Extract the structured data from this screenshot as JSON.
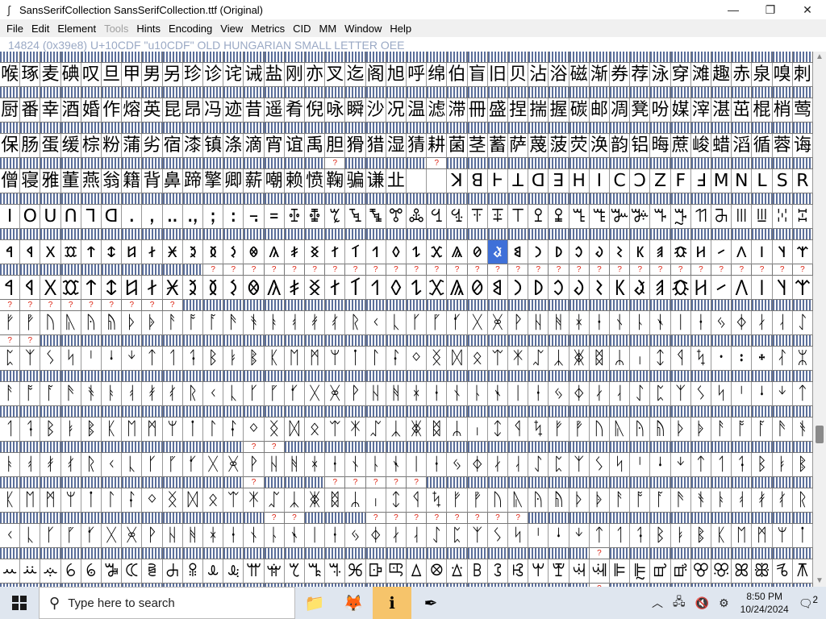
{
  "window": {
    "title": "SansSerifCollection  SansSerifCollection.ttf (Original)",
    "app_icon": "fontforge-icon",
    "controls": [
      "—",
      "❐",
      "✕"
    ]
  },
  "menu": {
    "items": [
      {
        "label": "File",
        "enabled": true
      },
      {
        "label": "Edit",
        "enabled": true
      },
      {
        "label": "Element",
        "enabled": true
      },
      {
        "label": "Tools",
        "enabled": false
      },
      {
        "label": "Hints",
        "enabled": true
      },
      {
        "label": "Encoding",
        "enabled": true
      },
      {
        "label": "View",
        "enabled": true
      },
      {
        "label": "Metrics",
        "enabled": true
      },
      {
        "label": "CID",
        "enabled": true
      },
      {
        "label": "MM",
        "enabled": true
      },
      {
        "label": "Window",
        "enabled": true
      },
      {
        "label": "Help",
        "enabled": true
      }
    ]
  },
  "info": {
    "glyph_info": "14824 (0x39e8) U+10CDF \"u10CDF\" OLD HUNGARIAN SMALL LETTER OEE"
  },
  "grid": {
    "columns": 40,
    "selected_row": 5,
    "selected_col": 24,
    "rows": [
      {
        "glyphs": [
          "喉",
          "琢",
          "麦",
          "碘",
          "叹",
          "旦",
          "甲",
          "男",
          "另",
          "珍",
          "诊",
          "诧",
          "诫",
          "盐",
          "刚",
          "亦",
          "叉",
          "迄",
          "阁",
          "旭",
          "呼",
          "绵",
          "伯",
          "盲",
          "旧",
          "贝",
          "沾",
          "浴",
          "磁",
          "渐",
          "券",
          "荐",
          "泳",
          "穿",
          "滩",
          "趣",
          "赤",
          "泉",
          "嗅",
          "刺"
        ],
        "marks": []
      },
      {
        "glyphs": [
          "厨",
          "番",
          "幸",
          "酒",
          "婚",
          "作",
          "熔",
          "英",
          "昆",
          "昂",
          "冯",
          "迹",
          "昔",
          "遥",
          "肴",
          "倪",
          "咏",
          "瞬",
          "沙",
          "况",
          "温",
          "滤",
          "滞",
          "冊",
          "盛",
          "捏",
          "揣",
          "握",
          "碳",
          "邮",
          "凋",
          "凳",
          "吩",
          "媒",
          "滓",
          "湛",
          "茁",
          "棍",
          "梢",
          "莺"
        ],
        "marks": []
      },
      {
        "glyphs": [
          "保",
          "肠",
          "蛋",
          "缓",
          "棕",
          "粉",
          "蒲",
          "劣",
          "宿",
          "漆",
          "镇",
          "涤",
          "滴",
          "宵",
          "谊",
          "禹",
          "胆",
          "猾",
          "猎",
          "湿",
          "猜",
          "耕",
          "菌",
          "茎",
          "蓄",
          "萨",
          "蔑",
          "菠",
          "荧",
          "涣",
          "韵",
          "铝",
          "晦",
          "蔗",
          "峻",
          "蜡",
          "滔",
          "循",
          "蓉",
          "诲"
        ],
        "marks": []
      },
      {
        "glyphs": [
          "僧",
          "寝",
          "雅",
          "董",
          "燕",
          "翁",
          "籍",
          "背",
          "鼻",
          "蹄",
          "擎",
          "卿",
          "薪",
          "嘲",
          "赖",
          "愤",
          "鞠",
          "骗",
          "谦",
          "㐀",
          "",
          "",
          "",
          "",
          "",
          "",
          "",
          "",
          "",
          "",
          "",
          "",
          "",
          "",
          "",
          "",
          "",
          "",
          "",
          ""
        ],
        "marks": [
          16,
          21
        ],
        "glyph_override": {
          "20": "",
          "21": "",
          "22": "ꓘ",
          "23": "ꓭ",
          "24": "Ⱶ",
          "25": "ꓕ",
          "26": "ꓷ",
          "27": "ꓱ",
          "28": "ꓧ",
          "29": "ꓲ",
          "30": "ꓚ",
          "31": "ꓛ",
          "32": "ꓜ",
          "33": "ꓝ",
          "34": "ꓞ",
          "35": "ꓟ",
          "36": "ꓠ",
          "37": "ꓡ",
          "38": "ꓢ",
          "39": "ꓣ"
        }
      },
      {
        "glyphs": [
          "ꓲ",
          "ꓳ",
          "ꓴ",
          "ꓵ",
          "ꓶ",
          "ꓷ",
          "ꓸ",
          "ꓹ",
          "ꓺ",
          "ꓻ",
          "ꓼ",
          "ꓽ",
          "꓾",
          "꓿",
          "ꔀ",
          "ꔁ",
          "ꔂ",
          "ꔃ",
          "ꔄ",
          "ꔅ",
          "ꔆ",
          "ꔇ",
          "ꔈ",
          "ꔉ",
          "ꔊ",
          "ꔋ",
          "ꔌ",
          "ꔍ",
          "ꔎ",
          "ꔏ",
          "ꔐ",
          "ꔑ",
          "ꔒ",
          "ꔓ",
          "ꔔ",
          "ꔕ",
          "ꔖ",
          "ꔗ",
          "ꔘ",
          "ꔙ"
        ],
        "marks": []
      },
      {
        "glyphs": [
          "𐳀",
          "𐳁",
          "𐳂",
          "𐳃",
          "𐳄",
          "𐳅",
          "𐳆",
          "𐳇",
          "𐳈",
          "𐳉",
          "𐳊",
          "𐳋",
          "𐳌",
          "𐳍",
          "𐳎",
          "𐳏",
          "𐳐",
          "𐳑",
          "𐳒",
          "𐳓",
          "𐳔",
          "𐳕",
          "𐳖",
          "𐳗",
          "𐳟",
          "𐳘",
          "𐳙",
          "𐳚",
          "𐳛",
          "𐳜",
          "𐳝",
          "𐳞",
          "𐳠",
          "𐳡",
          "𐳢",
          "𐳣",
          "𐳤",
          "𐳥",
          "𐳦",
          "𐳧"
        ],
        "marks": []
      },
      {
        "glyphs": [
          "𐲀",
          "𐲁",
          "𐲂",
          "𐲃",
          "𐲄",
          "𐲅",
          "𐲆",
          "𐲇",
          "𐲈",
          "𐲉",
          "𐲊",
          "𐲋",
          "𐲌",
          "𐲍",
          "𐲎",
          "𐲏",
          "𐲐",
          "𐲑",
          "𐲒",
          "𐲓",
          "𐲔",
          "𐲕",
          "𐲖",
          "𐲗",
          "𐲘",
          "𐲙",
          "𐲚",
          "𐲛",
          "𐲜",
          "𐲝",
          "𐲞",
          "𐲟",
          "𐲠",
          "𐲡",
          "𐲢",
          "𐲣",
          "𐲤",
          "𐲥",
          "𐲦",
          "𐲧"
        ],
        "marks": [
          10,
          11,
          12,
          13,
          14,
          15,
          16,
          17,
          18,
          19,
          20,
          21,
          22,
          23,
          24,
          25,
          26,
          27,
          28,
          29,
          30,
          31,
          32,
          33,
          34,
          35,
          36,
          37,
          38,
          39
        ]
      },
      {
        "glyphs": [
          "ᚠ",
          "ᚡ",
          "ᚢ",
          "ᚣ",
          "ᚤ",
          "ᚥ",
          "ᚦ",
          "ᚧ",
          "ᚨ",
          "ᚩ",
          "ᚪ",
          "ᚫ",
          "ᚬ",
          "ᚭ",
          "ᚮ",
          "ᚯ",
          "ᚰ",
          "ᚱ",
          "ᚲ",
          "ᚳ",
          "ᚴ",
          "ᚵ",
          "ᚶ",
          "ᚷ",
          "ᚸ",
          "ᚹ",
          "ᚺ",
          "ᚻ",
          "ᚼ",
          "ᚽ",
          "ᚾ",
          "ᚿ",
          "ᛀ",
          "ᛁ",
          "ᛂ",
          "ᛃ",
          "ᛄ",
          "ᛅ",
          "ᛆ",
          "ᛇ"
        ],
        "marks": [
          0,
          1,
          2,
          3,
          4,
          5,
          6,
          7,
          8
        ]
      },
      {
        "glyphs": [
          "ᛈ",
          "ᛉ",
          "ᛊ",
          "ᛋ",
          "ᛌ",
          "ᛍ",
          "ᛎ",
          "ᛏ",
          "ᛐ",
          "ᛑ",
          "ᛒ",
          "ᛓ",
          "ᛔ",
          "ᛕ",
          "ᛖ",
          "ᛗ",
          "ᛘ",
          "ᛙ",
          "ᛚ",
          "ᛛ",
          "ᛜ",
          "ᛝ",
          "ᛞ",
          "ᛟ",
          "ᛠ",
          "ᛡ",
          "ᛢ",
          "ᛣ",
          "ᛤ",
          "ᛥ",
          "ᛦ",
          "ᛧ",
          "ᛨ",
          "ᛩ",
          "ᛪ",
          "᛫",
          "᛬",
          "᛭",
          "ᛮ",
          "ᛯ"
        ],
        "marks": [
          0,
          1
        ]
      },
      {
        "glyphs": [
          "ᚨ",
          "ᚩ",
          "ᚪ",
          "ᚫ",
          "ᚬ",
          "ᚭ",
          "ᚮ",
          "ᚯ",
          "ᚰ",
          "ᚱ",
          "ᚲ",
          "ᚳ",
          "ᚴ",
          "ᚵ",
          "ᚶ",
          "ᚷ",
          "ᚸ",
          "ᚹ",
          "ᚺ",
          "ᚻ",
          "ᚼ",
          "ᚽ",
          "ᚾ",
          "ᚿ",
          "ᛀ",
          "ᛁ",
          "ᛂ",
          "ᛃ",
          "ᛄ",
          "ᛅ",
          "ᛆ",
          "ᛇ",
          "ᛈ",
          "ᛉ",
          "ᛊ",
          "ᛋ",
          "ᛌ",
          "ᛍ",
          "ᛎ",
          "ᛏ"
        ],
        "marks": []
      },
      {
        "glyphs": [
          "ᛐ",
          "ᛑ",
          "ᛒ",
          "ᛓ",
          "ᛔ",
          "ᛕ",
          "ᛖ",
          "ᛗ",
          "ᛘ",
          "ᛙ",
          "ᛚ",
          "ᛛ",
          "ᛜ",
          "ᛝ",
          "ᛞ",
          "ᛟ",
          "ᛠ",
          "ᛡ",
          "ᛢ",
          "ᛣ",
          "ᛤ",
          "ᛥ",
          "ᛦ",
          "ᛧ",
          "ᛨ",
          "ᛩ",
          "ᛪ",
          "ᚠ",
          "ᚡ",
          "ᚢ",
          "ᚣ",
          "ᚤ",
          "ᚥ",
          "ᚦ",
          "ᚧ",
          "ᚨ",
          "ᚩ",
          "ᚪ",
          "ᚫ",
          "ᚬ"
        ],
        "marks": []
      },
      {
        "glyphs": [
          "ᚭ",
          "ᚮ",
          "ᚯ",
          "ᚰ",
          "ᚱ",
          "ᚲ",
          "ᚳ",
          "ᚴ",
          "ᚵ",
          "ᚶ",
          "ᚷ",
          "ᚸ",
          "ᚹ",
          "ᚺ",
          "ᚻ",
          "ᚼ",
          "ᚽ",
          "ᚾ",
          "ᚿ",
          "ᛀ",
          "ᛁ",
          "ᛂ",
          "ᛃ",
          "ᛄ",
          "ᛅ",
          "ᛆ",
          "ᛇ",
          "ᛈ",
          "ᛉ",
          "ᛊ",
          "ᛋ",
          "ᛌ",
          "ᛍ",
          "ᛎ",
          "ᛏ",
          "ᛐ",
          "ᛑ",
          "ᛒ",
          "ᛓ",
          "ᛔ"
        ],
        "marks": [
          12,
          13
        ]
      },
      {
        "glyphs": [
          "ᛕ",
          "ᛖ",
          "ᛗ",
          "ᛘ",
          "ᛙ",
          "ᛚ",
          "ᛛ",
          "ᛜ",
          "ᛝ",
          "ᛞ",
          "ᛟ",
          "ᛠ",
          "ᛡ",
          "ᛢ",
          "ᛣ",
          "ᛤ",
          "ᛥ",
          "ᛦ",
          "ᛧ",
          "ᛨ",
          "ᛩ",
          "ᛪ",
          "ᚠ",
          "ᚡ",
          "ᚢ",
          "ᚣ",
          "ᚤ",
          "ᚥ",
          "ᚦ",
          "ᚧ",
          "ᚨ",
          "ᚩ",
          "ᚪ",
          "ᚫ",
          "ᚬ",
          "ᚭ",
          "ᚮ",
          "ᚯ",
          "ᚰ",
          "ᚱ"
        ],
        "marks": [
          12,
          16,
          17,
          18,
          19,
          20
        ]
      },
      {
        "glyphs": [
          "ᚲ",
          "ᚳ",
          "ᚴ",
          "ᚵ",
          "ᚶ",
          "ᚷ",
          "ᚸ",
          "ᚹ",
          "ᚺ",
          "ᚻ",
          "ᚼ",
          "ᚽ",
          "ᚾ",
          "ᚿ",
          "ᛀ",
          "ᛁ",
          "ᛂ",
          "ᛃ",
          "ᛄ",
          "ᛅ",
          "ᛆ",
          "ᛇ",
          "ᛈ",
          "ᛉ",
          "ᛊ",
          "ᛋ",
          "ᛌ",
          "ᛍ",
          "ᛎ",
          "ᛏ",
          "ᛐ",
          "ᛑ",
          "ᛒ",
          "ᛓ",
          "ᛔ",
          "ᛕ",
          "ᛖ",
          "ᛗ",
          "ᛘ",
          "ᛙ"
        ],
        "marks": [
          13,
          14,
          18,
          19,
          20,
          21,
          22,
          23,
          24,
          25
        ]
      },
      {
        "glyphs": [
          "ꕀ",
          "ꕁ",
          "ꕂ",
          "ꕃ",
          "ꕄ",
          "ꕅ",
          "ꕆ",
          "ꕇ",
          "ꕈ",
          "ꕉ",
          "ꕊ",
          "ꕋ",
          "ꕌ",
          "ꕍ",
          "ꕎ",
          "ꕏ",
          "ꕐ",
          "ꕑ",
          "ꕒ",
          "ꕓ",
          "ꕔ",
          "ꕕ",
          "ꕖ",
          "ꕗ",
          "ꕘ",
          "ꕙ",
          "ꕚ",
          "ꕛ",
          "ꕜ",
          "ꕝ",
          "ꕞ",
          "ꕟ",
          "ꕠ",
          "ꕡ",
          "ꕢ",
          "ꕣ",
          "ꕤ",
          "ꕥ",
          "ꕦ",
          "ꕧ"
        ],
        "marks": [
          29
        ]
      },
      {
        "glyphs": [
          "ᚱ",
          "ᛋ",
          "ᐁ",
          "ᑕ",
          "ᑊ",
          "ᑭ",
          "ᒋ",
          "ᓱ",
          "ᙧ",
          "ᗰ",
          "ᘔ",
          "ᘚ",
          "ᙀ",
          "ᙁ",
          "ᙂ",
          "ᙃ",
          "ᗩ",
          "ᗪ",
          "ᗫ",
          "ᗬ",
          "ᗭ",
          "ᗮ",
          "ᗯ",
          "ᗰ",
          "ᗱ",
          "ᗲ",
          "ᗳ",
          "ᗴ",
          "ᗵ",
          "ᗶ",
          "ᗷ",
          "ᗸ",
          "ᗹ",
          "ᗺ",
          "ᗻ",
          "ᗼ",
          "ᗽ",
          "ᗾ",
          "ᗿ",
          "ᘀ"
        ],
        "marks": [
          29
        ]
      }
    ]
  },
  "scrollbar": {
    "up": "▲",
    "down": "▼",
    "position": 0.72
  },
  "taskbar": {
    "search_placeholder": "Type here to search",
    "apps": [
      {
        "name": "file-explorer-icon",
        "glyph": "📁",
        "active": false
      },
      {
        "name": "firefox-icon",
        "glyph": "🦊",
        "active": false
      },
      {
        "name": "info-app-icon",
        "glyph": "ℹ",
        "active": true
      },
      {
        "name": "fontforge-taskbar-icon",
        "glyph": "✒",
        "active": false
      }
    ],
    "time": "8:50 PM",
    "date": "10/24/2024",
    "notification_count": "2"
  }
}
